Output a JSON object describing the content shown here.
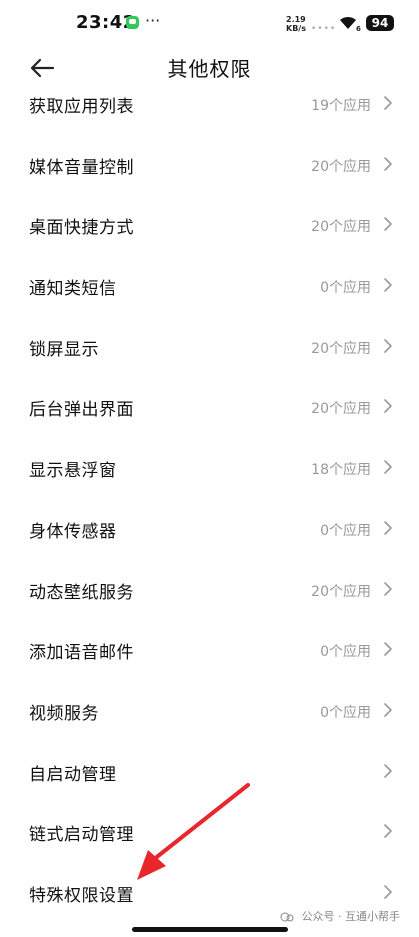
{
  "status": {
    "time": "23:42",
    "notification_dots": "···",
    "net_speed_value": "2.19",
    "net_speed_unit": "KB/s",
    "wifi_sub": "6",
    "battery": "94"
  },
  "header": {
    "title": "其他权限"
  },
  "items": [
    {
      "label": "获取应用列表",
      "value": "19个应用"
    },
    {
      "label": "媒体音量控制",
      "value": "20个应用"
    },
    {
      "label": "桌面快捷方式",
      "value": "20个应用"
    },
    {
      "label": "通知类短信",
      "value": "0个应用"
    },
    {
      "label": "锁屏显示",
      "value": "20个应用"
    },
    {
      "label": "后台弹出界面",
      "value": "20个应用"
    },
    {
      "label": "显示悬浮窗",
      "value": "18个应用"
    },
    {
      "label": "身体传感器",
      "value": "0个应用"
    },
    {
      "label": "动态壁纸服务",
      "value": "20个应用"
    },
    {
      "label": "添加语音邮件",
      "value": "0个应用"
    },
    {
      "label": "视频服务",
      "value": "0个应用"
    },
    {
      "label": "自启动管理",
      "value": ""
    },
    {
      "label": "链式启动管理",
      "value": ""
    },
    {
      "label": "特殊权限设置",
      "value": ""
    }
  ],
  "watermark": "公众号 · 互通小帮手",
  "colors": {
    "annotation_arrow": "#e8262b",
    "secondary_text": "#999999",
    "battery_bg": "#111111"
  }
}
